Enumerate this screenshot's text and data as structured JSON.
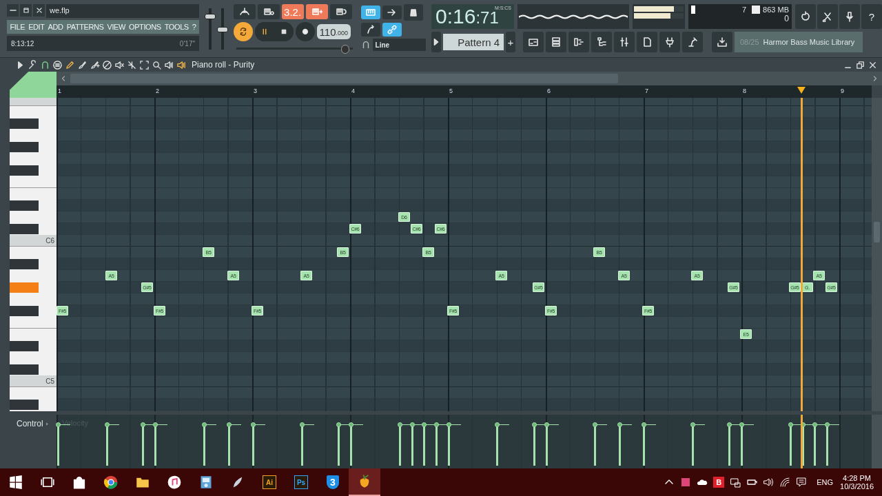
{
  "titlebar": {
    "filename": "we.flp"
  },
  "menu": [
    "FILE",
    "EDIT",
    "ADD",
    "PATTERNS",
    "VIEW",
    "OPTIONS",
    "TOOLS",
    "?"
  ],
  "hint_bar": {
    "left": "8:13:12",
    "right": "0'17''"
  },
  "master_volume": {
    "level": 0.82
  },
  "master_pitch": {
    "level": 0.5
  },
  "transport": {
    "countdown": "3.2.",
    "tempo_whole": "110",
    "tempo_fraction": ".000",
    "tempo_slider": {
      "level": 0.96
    }
  },
  "snap": "Line",
  "clock": {
    "main": "0:16",
    "fraction": ":71",
    "format": "M:S:CS"
  },
  "pattern": {
    "name": "Pattern 4",
    "add": "+"
  },
  "output_meter": [
    {
      "level": 0.8
    },
    {
      "level": 0.74
    }
  ],
  "cpu": {
    "value": "7",
    "memory": "863 MB",
    "polyphony": "0"
  },
  "browser_hint": {
    "count": "08/25",
    "title": "Harmor Bass Music Library"
  },
  "help": "?",
  "piano_roll": {
    "title": "Piano roll - Purity",
    "bars": [
      "1",
      "2",
      "3",
      "4",
      "5",
      "6",
      "7",
      "8",
      "9"
    ],
    "key_labels": [
      "C6",
      "C5"
    ],
    "notes": [
      {
        "label": "F#5"
      },
      {
        "label": "A5"
      },
      {
        "label": "G#5"
      },
      {
        "label": "F#5"
      },
      {
        "label": "B5"
      },
      {
        "label": "A5"
      },
      {
        "label": "F#5"
      },
      {
        "label": "A5"
      },
      {
        "label": "B5"
      },
      {
        "label": "C#6"
      },
      {
        "label": "D6"
      },
      {
        "label": "C#6"
      },
      {
        "label": "B5"
      },
      {
        "label": "C#6"
      },
      {
        "label": "F#5"
      },
      {
        "label": "A5"
      },
      {
        "label": "G#5"
      },
      {
        "label": "F#5"
      },
      {
        "label": "B5"
      },
      {
        "label": "A5"
      },
      {
        "label": "F#5"
      },
      {
        "label": "A5"
      },
      {
        "label": "G#5"
      },
      {
        "label": "E5"
      },
      {
        "label": "G#5"
      },
      {
        "label": "G."
      },
      {
        "label": "A5"
      },
      {
        "label": "G#5"
      }
    ],
    "control": {
      "label": "Control",
      "target": "Velocity"
    }
  },
  "taskbar": {
    "apps": [
      {
        "kind": "start",
        "selected": false
      },
      {
        "kind": "taskview",
        "selected": false
      },
      {
        "kind": "store",
        "selected": false
      },
      {
        "kind": "browser",
        "selected": false
      },
      {
        "kind": "folder",
        "selected": false
      },
      {
        "kind": "music",
        "selected": false
      },
      {
        "kind": "player",
        "selected": false
      },
      {
        "kind": "feather",
        "selected": false
      },
      {
        "kind": "text",
        "label": "Ai",
        "color": "#f7a21b",
        "selected": false
      },
      {
        "kind": "text",
        "label": "Ps",
        "color": "#31a8ff",
        "selected": false
      },
      {
        "kind": "shield",
        "label": "3",
        "selected": false
      },
      {
        "kind": "fruit",
        "selected": true
      }
    ],
    "tray": {
      "badge": "B",
      "language": "ENG",
      "time": "4:28 PM",
      "date": "10/3/2016"
    }
  }
}
